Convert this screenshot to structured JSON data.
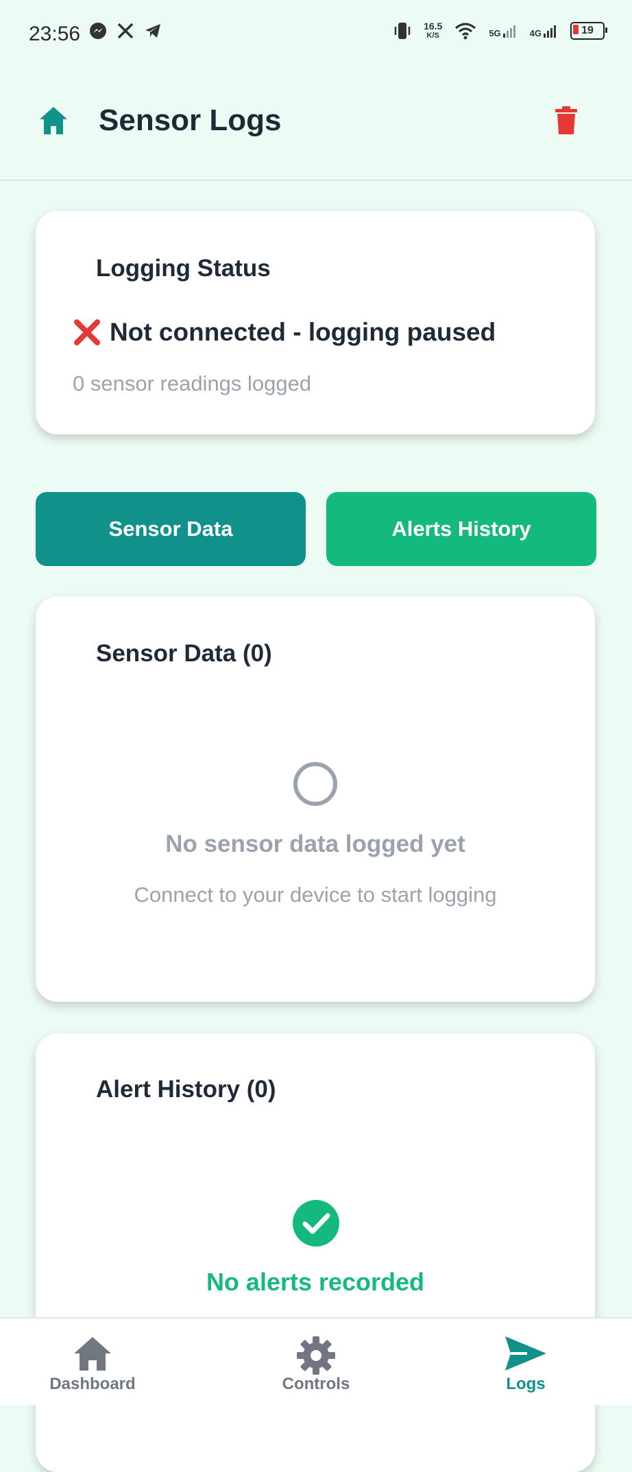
{
  "status_bar": {
    "time": "23:56",
    "speed_value": "16.5",
    "speed_unit": "K/S",
    "net1": "5G",
    "net2": "4G",
    "battery": "19"
  },
  "header": {
    "title": "Sensor Logs"
  },
  "logging_status": {
    "title": "Logging Status",
    "message": "Not connected - logging paused",
    "readings": "0 sensor readings logged"
  },
  "tabs": {
    "sensor_data": "Sensor Data",
    "alerts_history": "Alerts History"
  },
  "sensor_card": {
    "title": "Sensor Data (0)",
    "empty_title": "No sensor data logged yet",
    "empty_subtitle": "Connect to your device to start logging"
  },
  "alert_card": {
    "title": "Alert History (0)",
    "empty_title": "No alerts recorded"
  },
  "bottom_nav": {
    "dashboard": "Dashboard",
    "controls": "Controls",
    "logs": "Logs",
    "active": "logs"
  },
  "colors": {
    "background": "#ecfbf3",
    "primary_teal": "#10928a",
    "accent_green": "#14b97e",
    "danger_red": "#e53935",
    "muted_text": "#9aa3ad"
  },
  "icons": [
    "messenger-icon",
    "x-icon",
    "telegram-icon",
    "vibrate-icon",
    "wifi-icon",
    "signal-icon",
    "battery-icon",
    "home-icon",
    "trash-icon",
    "cross-mark-icon",
    "empty-circle-icon",
    "check-circle-icon",
    "gear-icon",
    "send-icon"
  ]
}
